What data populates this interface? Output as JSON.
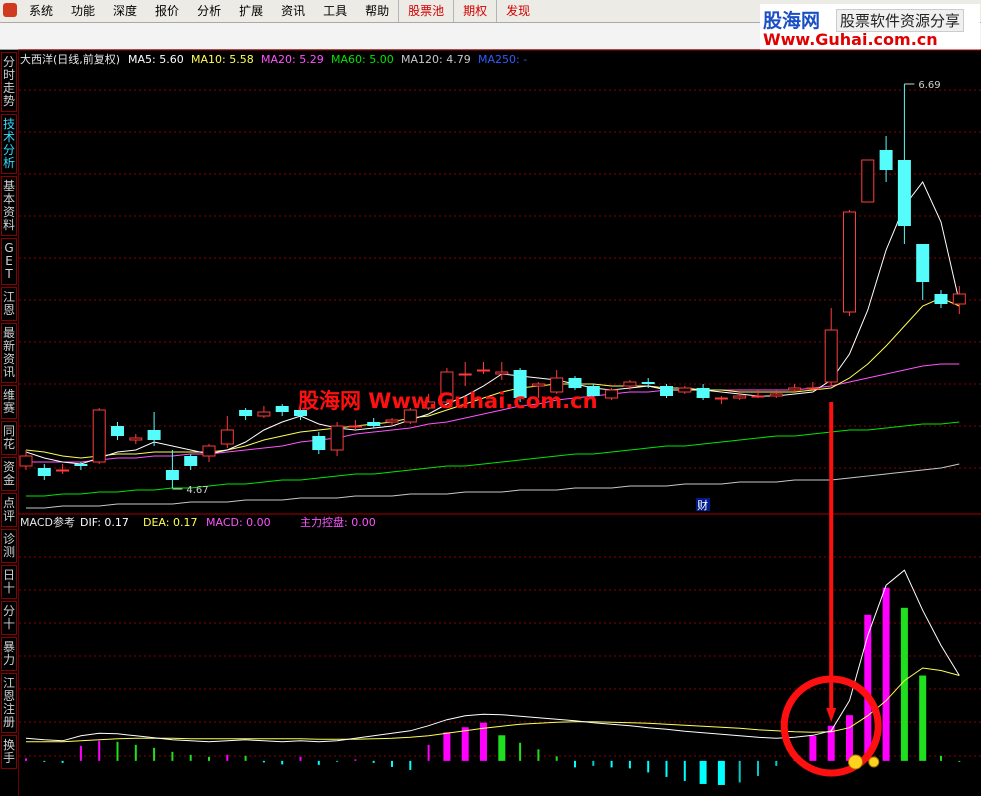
{
  "menu": {
    "items": [
      "系统",
      "功能",
      "深度",
      "报价",
      "分析",
      "扩展",
      "资讯",
      "工具",
      "帮助"
    ],
    "red_items": [
      "股票池",
      "期权",
      "发现"
    ]
  },
  "watermark": {
    "brand": "股海网",
    "slogan": "股票软件资源分享",
    "url": "Www.Guhai.com.cn"
  },
  "sidebar": {
    "tabs": [
      {
        "label": "分时走势",
        "active": false
      },
      {
        "label": "技术分析",
        "active": true
      },
      {
        "label": "基本资料",
        "active": false
      },
      {
        "label": "GET",
        "active": false
      },
      {
        "label": "江恩",
        "active": false
      },
      {
        "label": "最新资讯",
        "active": false
      },
      {
        "label": "维赛",
        "active": false
      },
      {
        "label": "同花",
        "active": false
      },
      {
        "label": "资金",
        "active": false
      },
      {
        "label": "点评",
        "active": false
      },
      {
        "label": "诊测",
        "active": false
      },
      {
        "label": "日十",
        "active": false
      },
      {
        "label": "分十",
        "active": false
      },
      {
        "label": "暴力",
        "active": false
      },
      {
        "label": "江恩注册",
        "active": false
      },
      {
        "label": "换手",
        "active": false
      }
    ]
  },
  "colors": {
    "up": "#ff3c3c",
    "down": "#54fcfc",
    "ma5": "#ffffff",
    "ma10": "#ffff54",
    "ma20": "#ff54ff",
    "ma60": "#00e600",
    "ma120": "#c8c8c8",
    "ma250": "#2e5cff",
    "grid": "#8b0000",
    "annot": "#ff1010"
  },
  "chart_data": [
    {
      "type": "candlestick",
      "title": "大西洋(日线,前复权)",
      "legend": [
        {
          "name": "MA5",
          "value": "5.60",
          "color": "#ffffff"
        },
        {
          "name": "MA10",
          "value": "5.58",
          "color": "#ffff54"
        },
        {
          "name": "MA20",
          "value": "5.29",
          "color": "#ff54ff"
        },
        {
          "name": "MA60",
          "value": "5.00",
          "color": "#00e600"
        },
        {
          "name": "MA120",
          "value": "4.79",
          "color": "#c8c8c8"
        },
        {
          "name": "MA250",
          "value": "-",
          "color": "#2e5cff"
        }
      ],
      "ylim": [
        4.55,
        6.83
      ],
      "candles": [
        [
          4.78,
          4.83,
          4.76,
          4.86
        ],
        [
          4.77,
          4.73,
          4.71,
          4.79
        ],
        [
          4.76,
          4.76,
          4.74,
          4.79
        ],
        [
          4.79,
          4.78,
          4.76,
          4.8
        ],
        [
          4.8,
          5.06,
          4.79,
          5.07
        ],
        [
          4.98,
          4.93,
          4.91,
          5.0
        ],
        [
          4.91,
          4.92,
          4.89,
          4.94
        ],
        [
          4.96,
          4.91,
          4.88,
          5.05
        ],
        [
          4.76,
          4.71,
          4.67,
          4.86
        ],
        [
          4.83,
          4.78,
          4.76,
          4.84
        ],
        [
          4.83,
          4.88,
          4.8,
          4.89
        ],
        [
          4.89,
          4.96,
          4.87,
          5.03
        ],
        [
          5.06,
          5.03,
          5.01,
          5.07
        ],
        [
          5.03,
          5.05,
          5.02,
          5.08
        ],
        [
          5.08,
          5.05,
          5.03,
          5.09
        ],
        [
          5.06,
          5.03,
          5.01,
          5.08
        ],
        [
          4.93,
          4.86,
          4.84,
          4.95
        ],
        [
          4.86,
          4.98,
          4.83,
          5.0
        ],
        [
          4.98,
          4.98,
          4.96,
          5.01
        ],
        [
          5.0,
          4.98,
          4.97,
          5.02
        ],
        [
          5.0,
          5.01,
          4.98,
          5.02
        ],
        [
          5.0,
          5.06,
          4.99,
          5.07
        ],
        [
          5.07,
          5.1,
          5.06,
          5.14
        ],
        [
          5.1,
          5.25,
          5.09,
          5.27
        ],
        [
          5.24,
          5.24,
          5.18,
          5.3
        ],
        [
          5.26,
          5.26,
          5.24,
          5.3
        ],
        [
          5.24,
          5.25,
          5.21,
          5.3
        ],
        [
          5.26,
          5.12,
          5.1,
          5.27
        ],
        [
          5.18,
          5.19,
          5.12,
          5.2
        ],
        [
          5.15,
          5.22,
          5.14,
          5.26
        ],
        [
          5.22,
          5.17,
          5.16,
          5.23
        ],
        [
          5.18,
          5.13,
          5.12,
          5.19
        ],
        [
          5.12,
          5.16,
          5.11,
          5.17
        ],
        [
          5.18,
          5.2,
          5.16,
          5.21
        ],
        [
          5.2,
          5.19,
          5.17,
          5.22
        ],
        [
          5.18,
          5.13,
          5.12,
          5.19
        ],
        [
          5.15,
          5.17,
          5.14,
          5.18
        ],
        [
          5.17,
          5.12,
          5.11,
          5.19
        ],
        [
          5.12,
          5.12,
          5.09,
          5.13
        ],
        [
          5.12,
          5.13,
          5.11,
          5.15
        ],
        [
          5.13,
          5.13,
          5.12,
          5.16
        ],
        [
          5.13,
          5.14,
          5.12,
          5.16
        ],
        [
          5.16,
          5.17,
          5.15,
          5.19
        ],
        [
          5.17,
          5.17,
          5.16,
          5.2
        ],
        [
          5.2,
          5.46,
          5.18,
          5.57
        ],
        [
          5.55,
          6.05,
          5.53,
          6.06
        ],
        [
          6.1,
          6.31,
          6.2,
          6.31
        ],
        [
          6.36,
          6.26,
          6.2,
          6.43
        ],
        [
          6.31,
          5.98,
          5.89,
          6.69
        ],
        [
          5.89,
          5.7,
          5.61,
          5.87
        ],
        [
          5.64,
          5.59,
          5.57,
          5.66
        ],
        [
          5.59,
          5.64,
          5.54,
          5.68
        ]
      ],
      "ma5": [
        4.85,
        4.82,
        4.8,
        4.79,
        4.82,
        4.85,
        4.86,
        4.9,
        4.88,
        4.86,
        4.84,
        4.86,
        4.9,
        4.96,
        5.0,
        5.03,
        4.99,
        4.97,
        4.96,
        4.97,
        4.98,
        5.01,
        5.04,
        5.09,
        5.13,
        5.18,
        5.24,
        5.23,
        5.22,
        5.21,
        5.19,
        5.17,
        5.16,
        5.17,
        5.18,
        5.16,
        5.16,
        5.16,
        5.15,
        5.14,
        5.13,
        5.13,
        5.14,
        5.15,
        5.21,
        5.34,
        5.56,
        5.86,
        6.08,
        6.2,
        6.0,
        5.6
      ],
      "ma10": [
        4.86,
        4.85,
        4.83,
        4.82,
        4.83,
        4.84,
        4.84,
        4.85,
        4.85,
        4.85,
        4.85,
        4.86,
        4.88,
        4.91,
        4.93,
        4.95,
        4.96,
        4.97,
        4.98,
        4.99,
        5.0,
        5.02,
        5.03,
        5.06,
        5.09,
        5.12,
        5.15,
        5.17,
        5.18,
        5.19,
        5.19,
        5.19,
        5.18,
        5.18,
        5.18,
        5.17,
        5.17,
        5.16,
        5.16,
        5.15,
        5.15,
        5.15,
        5.15,
        5.16,
        5.17,
        5.22,
        5.29,
        5.38,
        5.48,
        5.58,
        5.62,
        5.58
      ],
      "ma20": [
        4.8,
        4.8,
        4.8,
        4.8,
        4.81,
        4.82,
        4.82,
        4.83,
        4.83,
        4.84,
        4.84,
        4.85,
        4.86,
        4.87,
        4.88,
        4.9,
        4.91,
        4.92,
        4.94,
        4.95,
        4.96,
        4.97,
        4.99,
        5.0,
        5.02,
        5.04,
        5.06,
        5.08,
        5.09,
        5.11,
        5.12,
        5.13,
        5.14,
        5.15,
        5.15,
        5.16,
        5.16,
        5.16,
        5.16,
        5.16,
        5.16,
        5.16,
        5.16,
        5.17,
        5.18,
        5.2,
        5.22,
        5.24,
        5.26,
        5.28,
        5.29,
        5.29
      ],
      "ma60": [
        4.63,
        4.63,
        4.64,
        4.64,
        4.65,
        4.65,
        4.66,
        4.66,
        4.67,
        4.67,
        4.68,
        4.69,
        4.69,
        4.7,
        4.71,
        4.71,
        4.72,
        4.73,
        4.74,
        4.74,
        4.75,
        4.76,
        4.77,
        4.78,
        4.78,
        4.79,
        4.8,
        4.81,
        4.82,
        4.83,
        4.84,
        4.84,
        4.85,
        4.86,
        4.87,
        4.88,
        4.88,
        4.89,
        4.9,
        4.91,
        4.92,
        4.93,
        4.93,
        4.94,
        4.95,
        4.96,
        4.96,
        4.97,
        4.98,
        4.99,
        4.99,
        5.0
      ],
      "ma120": [
        4.57,
        4.57,
        4.58,
        4.58,
        4.58,
        4.59,
        4.59,
        4.59,
        4.59,
        4.6,
        4.6,
        4.6,
        4.61,
        4.61,
        4.61,
        4.62,
        4.62,
        4.62,
        4.63,
        4.63,
        4.63,
        4.64,
        4.64,
        4.64,
        4.65,
        4.65,
        4.65,
        4.66,
        4.66,
        4.66,
        4.67,
        4.67,
        4.67,
        4.68,
        4.68,
        4.68,
        4.69,
        4.69,
        4.69,
        4.7,
        4.7,
        4.7,
        4.71,
        4.71,
        4.71,
        4.72,
        4.73,
        4.74,
        4.75,
        4.76,
        4.77,
        4.79
      ],
      "annotations": {
        "high_label": "6.69",
        "low_label": "4.67",
        "event_label": "财"
      }
    },
    {
      "type": "bar",
      "title": "MACD参考",
      "legend": [
        {
          "name": "DIF",
          "value": "0.17",
          "color": "#ffffff"
        },
        {
          "name": "DEA",
          "value": "0.17",
          "color": "#ffff54"
        },
        {
          "name": "MACD",
          "value": "0.00",
          "color": "#ff54ff"
        },
        {
          "name": "主力控盘",
          "value": "0.00",
          "color": "#ff54ff"
        }
      ],
      "ylim": [
        -0.07,
        0.46
      ],
      "macd": [
        0.005,
        -0.002,
        -0.004,
        0.03,
        0.04,
        0.038,
        0.032,
        0.026,
        0.018,
        0.012,
        0.008,
        0.012,
        0.01,
        -0.003,
        -0.007,
        0.008,
        -0.008,
        -0.002,
        0.003,
        -0.004,
        -0.012,
        -0.018,
        0.032,
        0.057,
        0.067,
        0.076,
        0.051,
        0.036,
        0.023,
        0.009,
        -0.013,
        -0.01,
        -0.013,
        -0.015,
        -0.023,
        -0.032,
        -0.04,
        -0.046,
        -0.048,
        -0.043,
        -0.03,
        -0.01,
        0.019,
        0.05,
        0.07,
        0.091,
        0.291,
        0.345,
        0.305,
        0.17,
        0.01,
        0.0
      ],
      "dif": [
        0.045,
        0.042,
        0.04,
        0.05,
        0.055,
        0.054,
        0.05,
        0.046,
        0.042,
        0.04,
        0.038,
        0.04,
        0.042,
        0.04,
        0.038,
        0.04,
        0.038,
        0.04,
        0.045,
        0.05,
        0.055,
        0.06,
        0.07,
        0.082,
        0.09,
        0.093,
        0.092,
        0.089,
        0.086,
        0.083,
        0.08,
        0.076,
        0.073,
        0.07,
        0.066,
        0.063,
        0.059,
        0.056,
        0.053,
        0.05,
        0.047,
        0.045,
        0.047,
        0.051,
        0.06,
        0.12,
        0.25,
        0.35,
        0.38,
        0.3,
        0.23,
        0.17
      ],
      "dea": [
        0.038,
        0.038,
        0.038,
        0.04,
        0.042,
        0.044,
        0.045,
        0.045,
        0.045,
        0.044,
        0.044,
        0.044,
        0.044,
        0.044,
        0.044,
        0.044,
        0.043,
        0.043,
        0.043,
        0.044,
        0.045,
        0.047,
        0.05,
        0.055,
        0.06,
        0.065,
        0.069,
        0.073,
        0.075,
        0.077,
        0.078,
        0.078,
        0.077,
        0.076,
        0.075,
        0.073,
        0.071,
        0.069,
        0.067,
        0.065,
        0.062,
        0.06,
        0.058,
        0.057,
        0.058,
        0.066,
        0.09,
        0.12,
        0.16,
        0.185,
        0.18,
        0.17
      ]
    }
  ]
}
